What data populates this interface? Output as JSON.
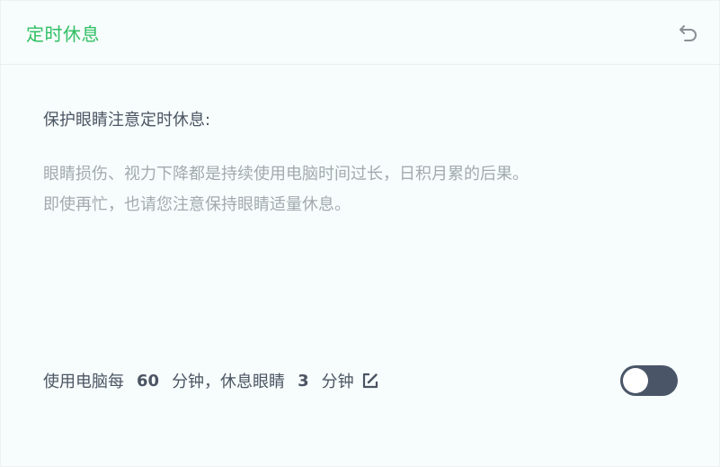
{
  "header": {
    "title": "定时休息",
    "reset_icon": "undo-icon"
  },
  "main": {
    "subtitle": "保护眼睛注意定时休息:",
    "description_lines": [
      "眼睛损伤、视力下降都是持续使用电脑时间过长，日积月累的后果。",
      "即使再忙，也请您注意保持眼睛适量休息。"
    ]
  },
  "setting": {
    "prefix": "使用电脑每",
    "work_minutes": "60",
    "middle": "分钟，休息眼睛",
    "rest_minutes": "3",
    "suffix": "分钟",
    "edit_icon": "edit-icon",
    "enabled": false
  },
  "colors": {
    "title": "#2fbf63",
    "toggle_off": "#4a5668",
    "background": "#f7fdfc"
  }
}
